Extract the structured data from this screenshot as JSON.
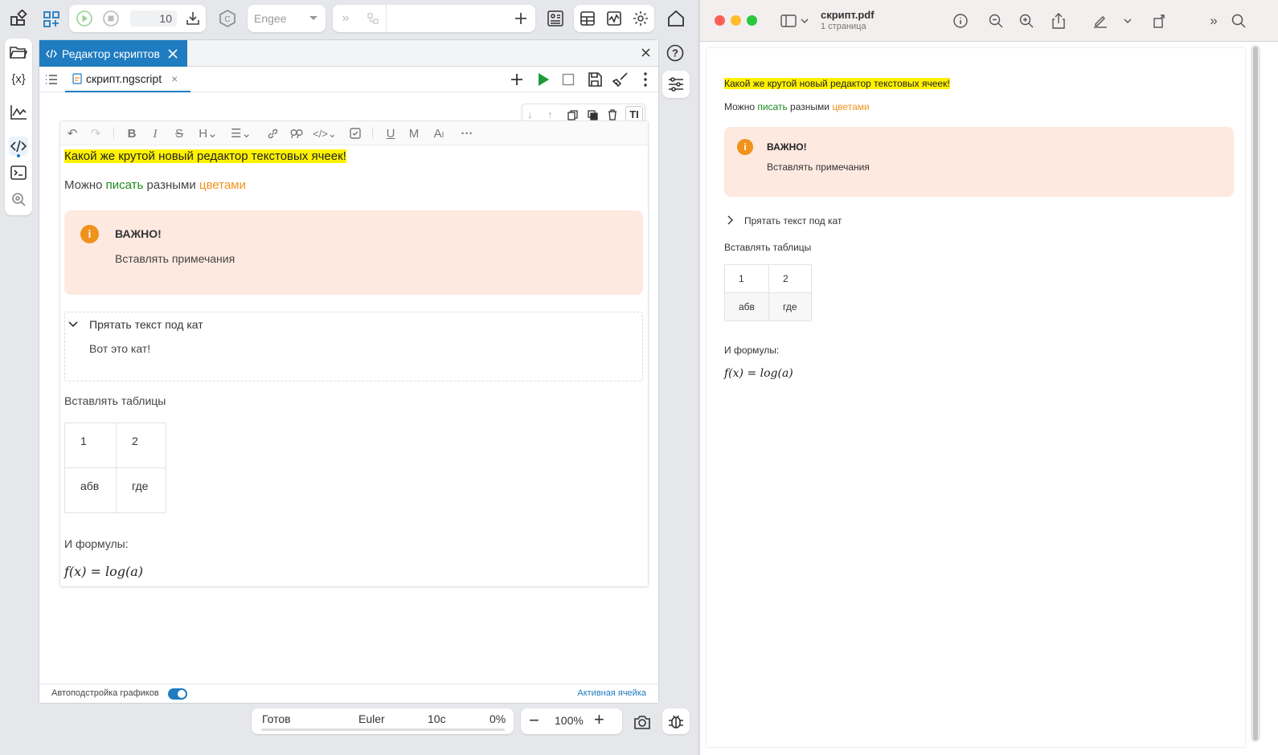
{
  "toolbar": {
    "run_count": "10",
    "env_select": "Engee"
  },
  "editor": {
    "main_tab": "Редактор скриптов",
    "file_tab": "скрипт.ngscript",
    "content": {
      "highlight": "Какой же крутой новый редактор текстовых ячеек!",
      "line2_a": "Можно",
      "line2_b": "писать",
      "line2_c": "разными",
      "line2_d": "цветами",
      "note_title": "ВАЖНО!",
      "note_text": "Вставлять примечания",
      "cut_title": "Прятать текст под кат",
      "cut_text": "Вот это кат!",
      "tables_label": "Вставлять таблицы",
      "table": [
        [
          "1",
          "2"
        ],
        [
          "абв",
          "где"
        ]
      ],
      "formula_label": "И формулы:",
      "formula": "f(x) = log(a)"
    },
    "colors": {
      "green": "#1e8a1e",
      "orange": "#f0921c",
      "highlight": "#fff200",
      "accent": "#1f7cc1"
    },
    "status": {
      "autoplot_label": "Автоподстройка графиков",
      "active_cell": "Активная ячейка"
    }
  },
  "bottom": {
    "state": "Готов",
    "solver": "Euler",
    "time": "10c",
    "progress": "0%",
    "zoom": "100%"
  },
  "pdf": {
    "title": "скрипт.pdf",
    "subtitle": "1 страница"
  }
}
